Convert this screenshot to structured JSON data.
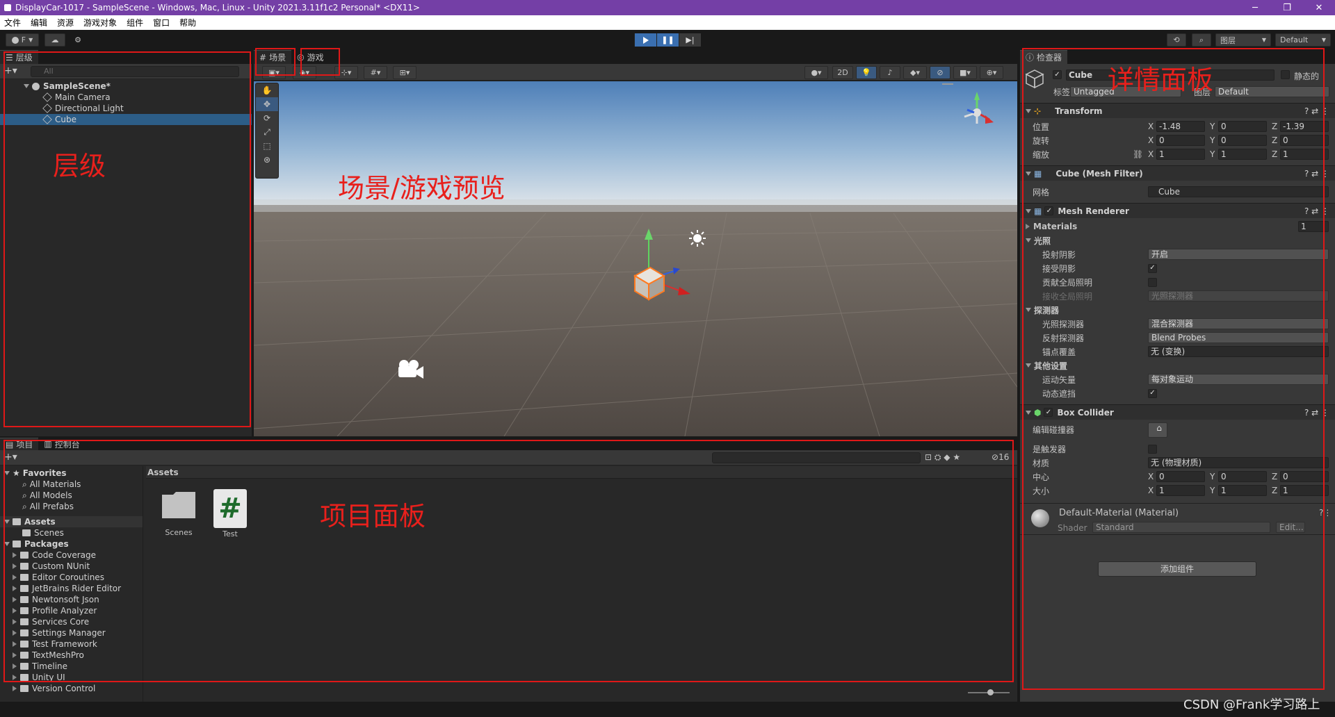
{
  "window": {
    "title": "DisplayCar-1017 - SampleScene - Windows, Mac, Linux - Unity 2021.3.11f1c2 Personal* <DX11>",
    "minimize": "─",
    "maximize": "❐",
    "close": "✕"
  },
  "menu": [
    "文件",
    "编辑",
    "资源",
    "游戏对象",
    "组件",
    "窗口",
    "帮助"
  ],
  "toolbar": {
    "account": "F",
    "layers_label": "图层",
    "layout_label": "Default"
  },
  "hierarchy": {
    "tab": "层级",
    "search_placeholder": "All",
    "scene": "SampleScene*",
    "items": [
      "Main Camera",
      "Directional Light",
      "Cube"
    ],
    "selected_index": 2
  },
  "scene_view": {
    "tabs": [
      "场景",
      "游戏"
    ],
    "mode_2d": "2D"
  },
  "project": {
    "tabs": [
      "项目",
      "控制台"
    ],
    "favorites_label": "Favorites",
    "favorites": [
      "All Materials",
      "All Models",
      "All Prefabs"
    ],
    "assets_label": "Assets",
    "assets_children": [
      "Scenes"
    ],
    "packages_label": "Packages",
    "packages": [
      "Code Coverage",
      "Custom NUnit",
      "Editor Coroutines",
      "JetBrains Rider Editor",
      "Newtonsoft Json",
      "Profile Analyzer",
      "Services Core",
      "Settings Manager",
      "Test Framework",
      "TextMeshPro",
      "Timeline",
      "Unity UI",
      "Version Control"
    ],
    "breadcrumb": "Assets",
    "grid_items": [
      "Scenes",
      "Test"
    ],
    "hidden_count": "16"
  },
  "inspector": {
    "tab": "检查器",
    "object_name": "Cube",
    "static_label": "静态的",
    "tag_label": "标签",
    "tag_value": "Untagged",
    "layer_label": "图层",
    "layer_value": "Default",
    "transform": {
      "title": "Transform",
      "position_label": "位置",
      "rotation_label": "旋转",
      "scale_label": "缩放",
      "position": [
        "-1.48",
        "0",
        "-1.39"
      ],
      "rotation": [
        "0",
        "0",
        "0"
      ],
      "scale": [
        "1",
        "1",
        "1"
      ]
    },
    "mesh_filter": {
      "title": "Cube (Mesh Filter)",
      "mesh_label": "网格",
      "mesh_value": "Cube"
    },
    "mesh_renderer": {
      "title": "Mesh Renderer",
      "materials_label": "Materials",
      "materials_count": "1",
      "lighting_label": "光照",
      "cast_shadows_label": "投射阴影",
      "cast_shadows_value": "开启",
      "receive_shadows_label": "接受阴影",
      "contribute_gi_label": "贡献全局照明",
      "receive_gi_label": "接收全局照明",
      "receive_gi_value": "光照探测器",
      "probes_label": "探测器",
      "light_probes_label": "光照探测器",
      "light_probes_value": "混合探测器",
      "reflection_probes_label": "反射探测器",
      "reflection_probes_value": "Blend Probes",
      "anchor_label": "锚点覆盖",
      "anchor_value": "无 (变换)",
      "other_label": "其他设置",
      "motion_label": "运动矢量",
      "motion_value": "每对象运动",
      "dynamic_occlusion_label": "动态遮挡"
    },
    "box_collider": {
      "title": "Box Collider",
      "edit_label": "编辑碰撞器",
      "trigger_label": "是触发器",
      "material_label": "材质",
      "material_value": "无 (物理材质)",
      "center_label": "中心",
      "size_label": "大小",
      "center": [
        "0",
        "0",
        "0"
      ],
      "size": [
        "1",
        "1",
        "1"
      ]
    },
    "material": {
      "title": "Default-Material (Material)",
      "shader_label": "Shader",
      "shader_value": "Standard",
      "edit_label": "Edit..."
    },
    "add_component": "添加组件"
  },
  "annotations": {
    "hierarchy": "层级",
    "scene": "场景/游戏预览",
    "project": "项目面板",
    "inspector": "详情面板"
  },
  "watermark": "CSDN @Frank学习路上"
}
